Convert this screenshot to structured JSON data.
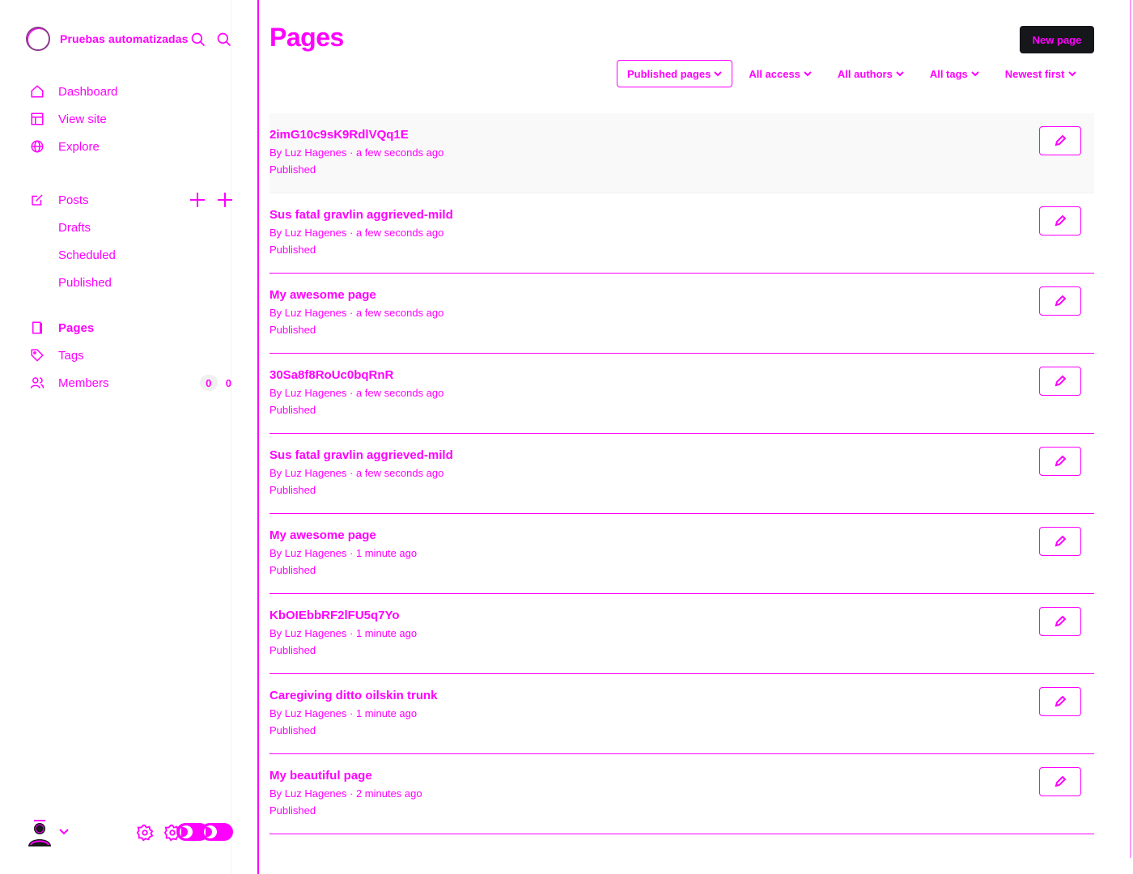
{
  "sidebar": {
    "site_title": "Pruebas automatizadas",
    "nav": [
      {
        "label": "Dashboard",
        "icon": "home-icon"
      },
      {
        "label": "View site",
        "icon": "layout-icon"
      },
      {
        "label": "Explore",
        "icon": "globe-icon"
      }
    ],
    "posts": {
      "label": "Posts",
      "icon": "edit-icon"
    },
    "post_sub": [
      "Drafts",
      "Scheduled",
      "Published"
    ],
    "pages": {
      "label": "Pages",
      "icon": "pages-icon"
    },
    "tags": {
      "label": "Tags",
      "icon": "tag-icon"
    },
    "members": {
      "label": "Members",
      "icon": "members-icon",
      "count": "0",
      "count2": "0"
    }
  },
  "header": {
    "title": "Pages",
    "new_button": "New page"
  },
  "filters": [
    "Published pages",
    "All access",
    "All authors",
    "All tags",
    "Newest first"
  ],
  "pages": [
    {
      "title": "2imG10c9sK9RdlVQq1E",
      "meta": "By Luz Hagenes · a few seconds ago",
      "status": "Published"
    },
    {
      "title": "Sus fatal gravlin aggrieved-mild",
      "meta": "By Luz Hagenes · a few seconds ago",
      "status": "Published"
    },
    {
      "title": "My awesome page",
      "meta": "By Luz Hagenes · a few seconds ago",
      "status": "Published"
    },
    {
      "title": "30Sa8f8RoUc0bqRnR",
      "meta": "By Luz Hagenes · a few seconds ago",
      "status": "Published"
    },
    {
      "title": "Sus fatal gravlin aggrieved-mild",
      "meta": "By Luz Hagenes · a few seconds ago",
      "status": "Published"
    },
    {
      "title": "My awesome page",
      "meta": "By Luz Hagenes · 1 minute ago",
      "status": "Published"
    },
    {
      "title": "KbOIEbbRF2lFU5q7Yo",
      "meta": "By Luz Hagenes · 1 minute ago",
      "status": "Published"
    },
    {
      "title": "Caregiving ditto oilskin trunk",
      "meta": "By Luz Hagenes · 1 minute ago",
      "status": "Published"
    },
    {
      "title": "My beautiful page",
      "meta": "By Luz Hagenes · 2 minutes ago",
      "status": "Published"
    }
  ]
}
